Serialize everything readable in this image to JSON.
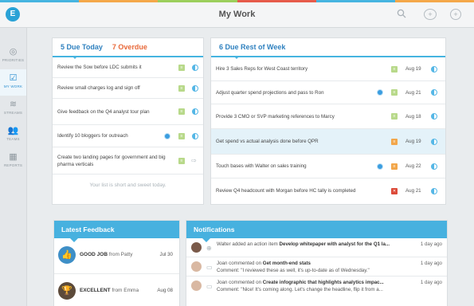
{
  "colors": {
    "accent": "#47b1df",
    "overdue": "#e8693a",
    "stripe": [
      "#46b4e0",
      "#f4a84a",
      "#9ccf5c",
      "#e65b4b",
      "#46b4e0",
      "#f4a84a"
    ]
  },
  "app": {
    "logo": "E",
    "title": "My Work"
  },
  "topbar": {
    "search_icon": "search-icon",
    "add_people_icon": "add-person-icon",
    "add_icon": "plus-icon"
  },
  "sidebar": {
    "items": [
      {
        "label": "PRIORITIES",
        "glyph": "◎",
        "icon": "target-icon"
      },
      {
        "label": "MY WORK",
        "glyph": "☑",
        "icon": "checkbox-icon"
      },
      {
        "label": "STREAMS",
        "glyph": "≋",
        "icon": "streams-icon"
      },
      {
        "label": "TEAMS",
        "glyph": "👥",
        "icon": "people-icon"
      },
      {
        "label": "REPORTS",
        "glyph": "▦",
        "icon": "calendar-icon"
      }
    ]
  },
  "today": {
    "due_label": "5 Due Today",
    "overdue_label": "7 Overdue",
    "tasks": [
      {
        "text": "Review the Sow before LDC submits it"
      },
      {
        "text": "Review small charges log and sign off"
      },
      {
        "text": "Give feedback on the Q4 analyst tour plan"
      },
      {
        "text": "Identify 10 bloggers for outreach"
      },
      {
        "text": "Create two landing pages for government and big pharma verticals"
      }
    ],
    "empty_message": "Your list is short and sweet today."
  },
  "week": {
    "title": "6 Due Rest of Week",
    "tasks": [
      {
        "text": "Hire 3 Sales Reps for West Coast territory",
        "date": "Aug 19"
      },
      {
        "text": "Adjust quarter spend projections and pass to Ron",
        "date": "Aug 21"
      },
      {
        "text": "Provide 3 CMO or SVP marketing references to Marcy",
        "date": "Aug 18"
      },
      {
        "text": "Get spend vs actual analysis done before QPR",
        "date": "Aug 19"
      },
      {
        "text": "Touch bases with Walter on sales training",
        "date": "Aug 22"
      },
      {
        "text": "Review Q4 headcount with Morgan before HC tally is completed",
        "date": "Aug 21"
      }
    ]
  },
  "feedback": {
    "title": "Latest Feedback",
    "items": [
      {
        "rating": "GOOD JOB",
        "from": "from Patty",
        "date": "Jul 30",
        "icon": "thumbs-up-icon",
        "glyph": "👍"
      },
      {
        "rating": "EXCELLENT",
        "from": "from Emma",
        "date": "Aug 08",
        "icon": "trophy-icon",
        "glyph": "🏆"
      }
    ]
  },
  "notifications": {
    "title": "Notifications",
    "items": [
      {
        "actor": "Walter",
        "action": " added an action item ",
        "target": "Develop whitepaper with analyst for the Q1 la...",
        "comment": "",
        "time": "1 day ago"
      },
      {
        "actor": "Joan",
        "action": " commented on ",
        "target": "Get month-end stats",
        "comment": "Comment: \"I reviewed these as well, it's up-to-date as of Wednesday.\"",
        "time": "1 day ago"
      },
      {
        "actor": "Joan",
        "action": " commented on ",
        "target": "Create infographic that highlights analytics impac...",
        "comment": "Comment: \"Nice! It's coming along. Let's change the headline, flip it from a...",
        "time": "1 day ago"
      }
    ]
  }
}
